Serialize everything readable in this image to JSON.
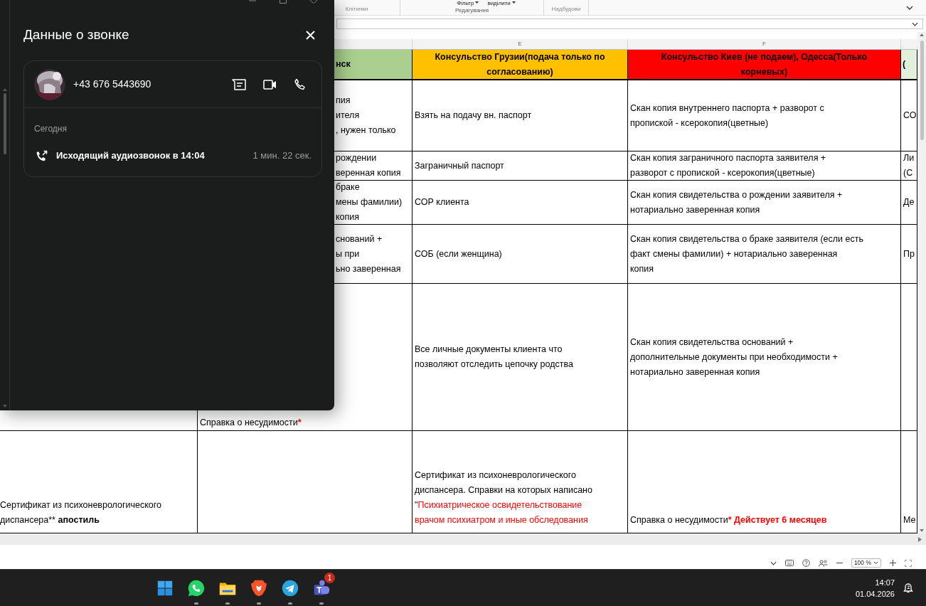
{
  "ribbon": {
    "buttons": [
      {
        "label": "Фільтр"
      },
      {
        "label": "виділити"
      }
    ],
    "groups": [
      "Клітинки",
      "Редагування",
      "Надбудови"
    ]
  },
  "call_window": {
    "title": "Данные о звонке",
    "contact": {
      "phone": "+43 676 5443690"
    },
    "date_label": "Сегодня",
    "calls": [
      {
        "label": "Исходящий аудиозвонок в 14:04",
        "duration": "1 мин. 22 сек."
      }
    ]
  },
  "sheet": {
    "column_letters": [
      "E",
      "F"
    ],
    "header_row": [
      {
        "lines": [
          "нск"
        ],
        "color": "#a9d08e"
      },
      {
        "lines": [
          "Консульство Грузии(подача только по",
          "согласованию)"
        ],
        "color": "#ffc000"
      },
      {
        "lines": [
          "Консульство Киев (не подаем), Одесса(Только",
          "корневых)"
        ],
        "color": "#ff0000"
      },
      {
        "lines": [
          "("
        ],
        "color": "#e2efda"
      }
    ],
    "rows": [
      {
        "cells": [
          null,
          {
            "lines": [
              "пия",
              "ителя",
              ", нужен только"
            ]
          },
          {
            "lines": [
              "Взять на подачу вн. паспорт"
            ]
          },
          {
            "lines": [
              "Скан копия внутреннего паспорта + разворот с",
              "пропиской - ксерокопия(цветные)"
            ]
          },
          {
            "lines": [
              "СО"
            ]
          }
        ]
      },
      {
        "cells": [
          null,
          {
            "lines": [
              "рождении",
              "веренная копия"
            ]
          },
          {
            "lines": [
              "Заграничный паспорт"
            ]
          },
          {
            "lines": [
              "Скан копия заграничного паспорта заявителя +",
              "разворот с пропиской - ксерокопия(цветные)"
            ]
          },
          {
            "lines": [
              "Ли",
              "(С"
            ]
          }
        ]
      },
      {
        "cells": [
          null,
          {
            "lines": [
              "браке",
              "мены фамилии)",
              "копия"
            ]
          },
          {
            "lines": [
              "СОР клиента"
            ]
          },
          {
            "lines": [
              "Скан копия свидетельства о рождении заявителя +",
              "нотариально заверенная копия"
            ]
          },
          {
            "lines": [
              "Де"
            ]
          }
        ]
      },
      {
        "cells": [
          null,
          {
            "lines": [
              "снований +",
              "ы при",
              "ьно заверенная"
            ]
          },
          {
            "lines": [
              "СОБ (если женщина)"
            ]
          },
          {
            "lines": [
              "Скан копия свидетельства о браке заявителя (если есть",
              "факт смены фамилии) + нотариально заверенная",
              "копия"
            ]
          },
          {
            "lines": [
              "Пр"
            ]
          }
        ]
      },
      {
        "cells": [
          null,
          {
            "lines": [
              [
                {
                  "text": "Справка о несудимости",
                  "red": false,
                  "bold": false
                },
                {
                  "text": "*",
                  "red": true,
                  "bold": true
                }
              ]
            ]
          },
          {
            "lines": [
              "Все личные документы клиента что",
              "позволяют отследить цепочку родства"
            ]
          },
          {
            "lines": [
              "Скан копия свидетельства оснований +",
              "дополнительные документы при необходимости +",
              "нотариально заверенная копия"
            ]
          },
          null
        ]
      },
      {
        "cells": [
          {
            "lines": [
              "Сертификат из психоневрологического",
              [
                {
                  "text": "диспансера** ",
                  "red": false,
                  "bold": false
                },
                {
                  "text": "апостиль",
                  "red": false,
                  "bold": true
                }
              ]
            ]
          },
          null,
          {
            "lines": [
              "Сертификат из психоневрологического",
              "диспансера. Справки на которых написано",
              [
                {
                  "text": "\"",
                  "red": false,
                  "bold": false
                },
                {
                  "text": "Психиатрическое освидетельствование",
                  "red": true,
                  "bold": false
                }
              ],
              [
                {
                  "text": "врачом психиатром и иные обследования",
                  "red": true,
                  "bold": false
                }
              ]
            ]
          },
          {
            "lines": [
              [
                {
                  "text": "Справка о несудимости",
                  "red": false,
                  "bold": false
                },
                {
                  "text": "*",
                  "red": true,
                  "bold": true
                },
                {
                  "text": " Действует 6 месяцев",
                  "red": true,
                  "bold": true
                }
              ]
            ]
          },
          {
            "lines": [
              "Ме"
            ]
          }
        ]
      }
    ]
  },
  "status_bar": {
    "zoom": "100 %"
  },
  "taskbar": {
    "apps": [
      {
        "kind": "windows",
        "running": false
      },
      {
        "kind": "whatsapp",
        "running": true
      },
      {
        "kind": "folder",
        "running": true
      },
      {
        "kind": "brave",
        "running": true
      },
      {
        "kind": "telegram",
        "running": true
      },
      {
        "kind": "teams",
        "running": true,
        "badge": "1"
      }
    ],
    "time": "14:07",
    "date": "01.04.2026"
  }
}
